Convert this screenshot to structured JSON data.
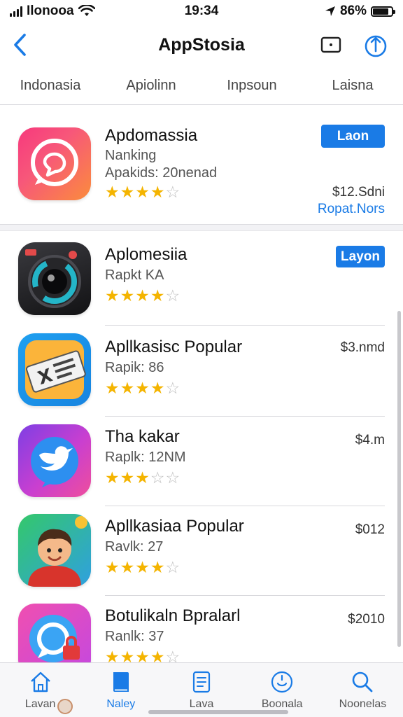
{
  "status_bar": {
    "carrier": "Ilonooa",
    "time": "19:34",
    "battery": "86%",
    "battery_level": 0.86,
    "signal_bars": 4
  },
  "nav": {
    "title": "AppStosia",
    "back_icon": "chevron-left-icon",
    "action_1_icon": "square-dot-icon",
    "action_2_icon": "share-icon"
  },
  "tabs": [
    {
      "label": "Indonasia",
      "active": true
    },
    {
      "label": "Apiolinn",
      "active": false
    },
    {
      "label": "Inpsoun",
      "active": false
    },
    {
      "label": "Laisna",
      "active": false
    }
  ],
  "featured": {
    "name": "Apdomassia",
    "subtitle": "Nanking",
    "meta": "Apakids: 20nenad",
    "rating": 4,
    "button": "Laon",
    "price": "$12.Sdni",
    "link": "Ropat.Nors",
    "icon": "chat-bubble-icon"
  },
  "apps": [
    {
      "name": "Aplomesiia",
      "subtitle": "Rapkt KA",
      "rating": 4,
      "button": "Layon",
      "price": "",
      "icon": "camera-lens-icon"
    },
    {
      "name": "Apllkasisc Popular",
      "subtitle": "Rapik: 86",
      "rating": 4,
      "button": "",
      "price": "$3.nmd",
      "icon": "ticket-icon"
    },
    {
      "name": "Tha kakar",
      "subtitle": "Raplk: 12NM",
      "rating": 3,
      "button": "",
      "price": "$4.m",
      "icon": "bird-icon"
    },
    {
      "name": "Apllkasiaa Popular",
      "subtitle": "Ravlk: 27",
      "rating": 4,
      "button": "",
      "price": "$012",
      "icon": "cartoon-boy-icon"
    },
    {
      "name": "Botulikaln Bpralarl",
      "subtitle": "Ranlk: 37",
      "rating": 4,
      "button": "",
      "price": "$2010",
      "icon": "chat-lock-icon"
    }
  ],
  "tabbar": [
    {
      "label": "Lavan",
      "icon": "home-icon",
      "active": false
    },
    {
      "label": "Naley",
      "icon": "book-icon",
      "active": true
    },
    {
      "label": "Lava",
      "icon": "document-icon",
      "active": false
    },
    {
      "label": "Boonala",
      "icon": "smiley-icon",
      "active": false
    },
    {
      "label": "Noonelas",
      "icon": "search-icon",
      "active": false
    }
  ],
  "colors": {
    "accent": "#1a7be6",
    "star": "#f4b400",
    "star_empty": "#bdbdbd"
  }
}
